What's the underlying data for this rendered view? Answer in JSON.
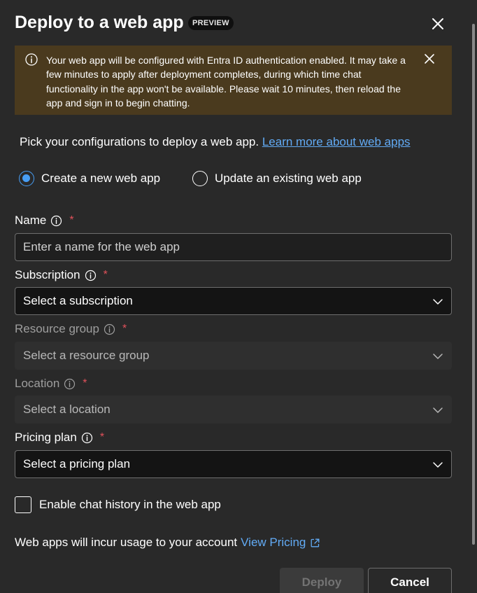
{
  "dialog": {
    "title": "Deploy to a web app",
    "badge": "PREVIEW"
  },
  "banner": {
    "text": "Your web app will be configured with Entra ID authentication enabled. It may take a few minutes to apply after deployment completes, during which time chat functionality in the app won't be available. Please wait 10 minutes, then reload the app and sign in to begin chatting."
  },
  "intro": {
    "text": "Pick your configurations to deploy a web app.",
    "link": "Learn more about web apps"
  },
  "mode": {
    "create_label": "Create a new web app",
    "update_label": "Update an existing web app",
    "selected": "create"
  },
  "fields": {
    "name": {
      "label": "Name",
      "placeholder": "Enter a name for the web app"
    },
    "subscription": {
      "label": "Subscription",
      "placeholder": "Select a subscription"
    },
    "resource_group": {
      "label": "Resource group",
      "placeholder": "Select a resource group"
    },
    "location": {
      "label": "Location",
      "placeholder": "Select a location"
    },
    "pricing_plan": {
      "label": "Pricing plan",
      "placeholder": "Select a pricing plan"
    },
    "required_mark": "*"
  },
  "chat_history": {
    "label": "Enable chat history in the web app",
    "checked": false
  },
  "footer": {
    "note": "Web apps will incur usage to your account",
    "pricing_link": "View Pricing"
  },
  "buttons": {
    "deploy": "Deploy",
    "cancel": "Cancel"
  },
  "colors": {
    "background": "#292929",
    "banner_background": "#4a3a1e",
    "accent": "#479ef5",
    "link": "#62abf5",
    "required": "#e0515a"
  },
  "icons": {
    "close": "close-icon",
    "info": "info-icon",
    "banner_dismiss": "dismiss-icon",
    "dropdown": "chevron-down-icon",
    "external": "external-link-icon"
  }
}
